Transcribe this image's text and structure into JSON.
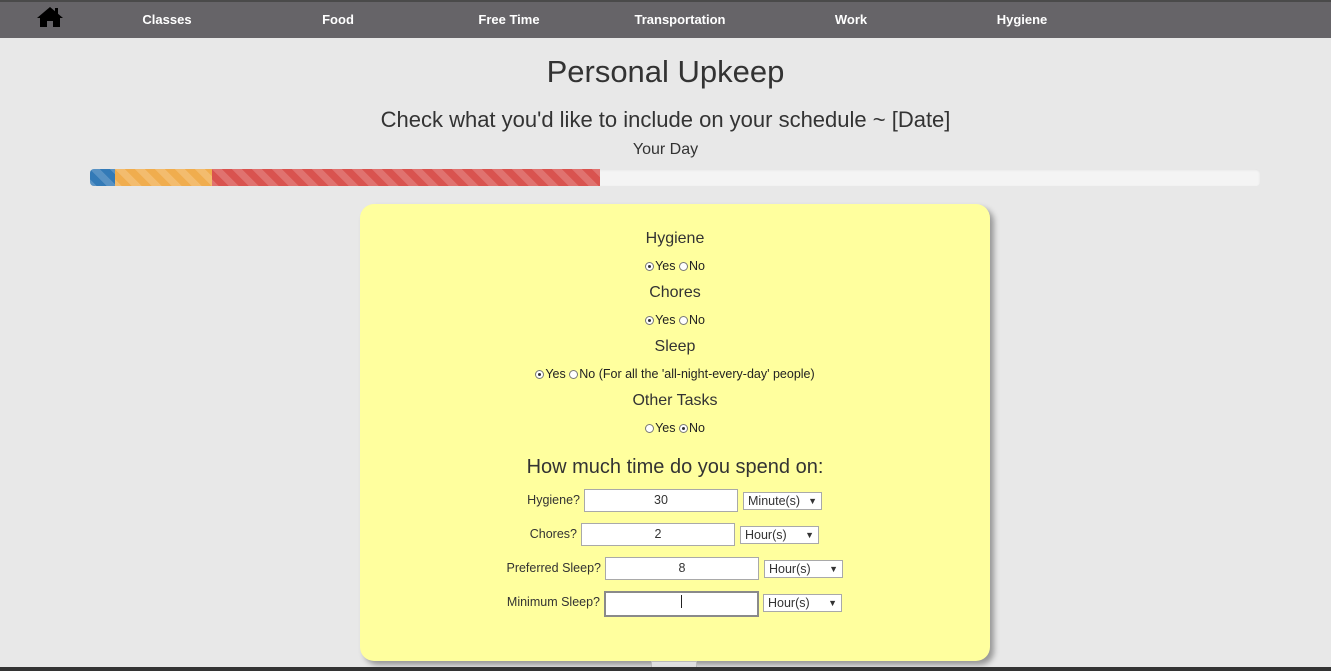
{
  "nav": {
    "home_icon": "home-icon",
    "items": [
      {
        "label": "Classes"
      },
      {
        "label": "Food"
      },
      {
        "label": "Free Time"
      },
      {
        "label": "Transportation"
      },
      {
        "label": "Work"
      },
      {
        "label": "Hygiene"
      }
    ]
  },
  "page": {
    "title": "Personal Upkeep",
    "subtitle": "Check what you'd like to include on your schedule ~ [Date]",
    "progress_caption": "Your Day"
  },
  "progress": {
    "segments": [
      {
        "color": "#337ab7",
        "fraction": 0.021
      },
      {
        "color": "#f0ad4e",
        "fraction": 0.083
      },
      {
        "color": "#d9534f",
        "fraction": 0.332
      }
    ]
  },
  "questions": [
    {
      "label": "Hygiene",
      "yes": "Yes",
      "no": "No",
      "note": "",
      "selected": "yes"
    },
    {
      "label": "Chores",
      "yes": "Yes",
      "no": "No",
      "note": "",
      "selected": "yes"
    },
    {
      "label": "Sleep",
      "yes": "Yes",
      "no": "No",
      "note": "(For all the 'all-night-every-day' people)",
      "selected": "yes"
    },
    {
      "label": "Other Tasks",
      "yes": "Yes",
      "no": "No",
      "note": "",
      "selected": "no"
    }
  ],
  "time_section": {
    "title": "How much time do you spend on:",
    "fields": [
      {
        "label": "Hygiene?",
        "value": "30",
        "unit": "Minute(s)"
      },
      {
        "label": "Chores?",
        "value": "2",
        "unit": "Hour(s)"
      },
      {
        "label": "Preferred Sleep?",
        "value": "8",
        "unit": "Hour(s)"
      },
      {
        "label": "Minimum Sleep?",
        "value": "",
        "unit": "Hour(s)"
      }
    ]
  }
}
